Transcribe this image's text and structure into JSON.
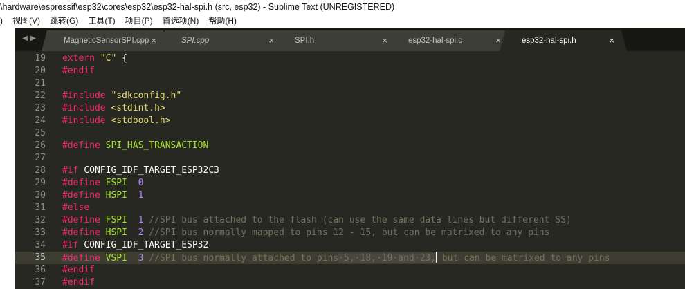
{
  "window": {
    "title": "\\hardware\\espressif\\esp32\\cores\\esp32\\esp32-hal-spi.h (src, esp32) - Sublime Text (UNREGISTERED)"
  },
  "menu": [
    ") ",
    "视图(V)",
    "跳转(G)",
    "工具(T)",
    "项目(P)",
    "首选项(N)",
    "帮助(H)"
  ],
  "tabs": [
    {
      "label": "MagneticSensorSPI.cpp"
    },
    {
      "label": "SPI.cpp"
    },
    {
      "label": "SPI.h"
    },
    {
      "label": "esp32-hal-spi.c"
    },
    {
      "label": "esp32-hal-spi.h"
    }
  ],
  "tab_close_glyph": "×",
  "nav": {
    "left": "◀",
    "right": "▶"
  },
  "current_line": 35,
  "lines": [
    {
      "no": "19",
      "tokens": [
        [
          "k",
          "extern"
        ],
        [
          "",
          " "
        ],
        [
          "s",
          "\"C\""
        ],
        [
          "",
          " {"
        ]
      ]
    },
    {
      "no": "20",
      "tokens": [
        [
          "k",
          "#endif"
        ]
      ]
    },
    {
      "no": "21",
      "tokens": []
    },
    {
      "no": "22",
      "tokens": [
        [
          "k",
          "#include"
        ],
        [
          "",
          " "
        ],
        [
          "s",
          "\"sdkconfig.h\""
        ]
      ]
    },
    {
      "no": "23",
      "tokens": [
        [
          "k",
          "#include"
        ],
        [
          "",
          " "
        ],
        [
          "s",
          "<stdint.h>"
        ]
      ]
    },
    {
      "no": "24",
      "tokens": [
        [
          "k",
          "#include"
        ],
        [
          "",
          " "
        ],
        [
          "s",
          "<stdbool.h>"
        ]
      ]
    },
    {
      "no": "25",
      "tokens": []
    },
    {
      "no": "26",
      "tokens": [
        [
          "k",
          "#define"
        ],
        [
          "",
          " "
        ],
        [
          "g",
          "SPI_HAS_TRANSACTION"
        ]
      ]
    },
    {
      "no": "27",
      "tokens": []
    },
    {
      "no": "28",
      "tokens": [
        [
          "k",
          "#if"
        ],
        [
          "",
          " CONFIG_IDF_TARGET_ESP32C3"
        ]
      ]
    },
    {
      "no": "29",
      "tokens": [
        [
          "k",
          "#define"
        ],
        [
          "",
          " "
        ],
        [
          "g",
          "FSPI"
        ],
        [
          "",
          "  "
        ],
        [
          "n",
          "0"
        ]
      ]
    },
    {
      "no": "30",
      "tokens": [
        [
          "k",
          "#define"
        ],
        [
          "",
          " "
        ],
        [
          "g",
          "HSPI"
        ],
        [
          "",
          "  "
        ],
        [
          "n",
          "1"
        ]
      ]
    },
    {
      "no": "31",
      "tokens": [
        [
          "k",
          "#else"
        ]
      ]
    },
    {
      "no": "32",
      "tokens": [
        [
          "k",
          "#define"
        ],
        [
          "",
          " "
        ],
        [
          "g",
          "FSPI"
        ],
        [
          "",
          "  "
        ],
        [
          "n",
          "1"
        ],
        [
          "",
          " "
        ],
        [
          "c",
          "//SPI bus attached to the flash (can use the same data lines but different SS)"
        ]
      ]
    },
    {
      "no": "33",
      "tokens": [
        [
          "k",
          "#define"
        ],
        [
          "",
          " "
        ],
        [
          "g",
          "HSPI"
        ],
        [
          "",
          "  "
        ],
        [
          "n",
          "2"
        ],
        [
          "",
          " "
        ],
        [
          "c",
          "//SPI bus normally mapped to pins 12 - 15, but can be matrixed to any pins"
        ]
      ]
    },
    {
      "no": "34",
      "tokens": [
        [
          "k",
          "#if"
        ],
        [
          "",
          " CONFIG_IDF_TARGET_ESP32"
        ]
      ]
    },
    {
      "no": "35",
      "tokens": [
        [
          "k",
          "#define"
        ],
        [
          "",
          " "
        ],
        [
          "g",
          "VSPI"
        ],
        [
          "",
          "  "
        ],
        [
          "n",
          "3"
        ],
        [
          "",
          " "
        ],
        [
          "c",
          "//SPI bus normally attached to pins"
        ],
        [
          "sel",
          "·5,·18,·19·and·23,"
        ],
        [
          "caret",
          ""
        ],
        [
          "c",
          " but can be matrixed to any pins"
        ]
      ]
    },
    {
      "no": "36",
      "tokens": [
        [
          "k",
          "#endif"
        ]
      ]
    },
    {
      "no": "37",
      "tokens": [
        [
          "k",
          "#endif"
        ]
      ]
    }
  ],
  "colors": {
    "background": "#272822",
    "keyword": "#f92672",
    "string": "#e6db74",
    "number": "#ae81ff",
    "comment": "#75715e",
    "entity": "#a6e22e",
    "gutter": "#8f908a"
  }
}
